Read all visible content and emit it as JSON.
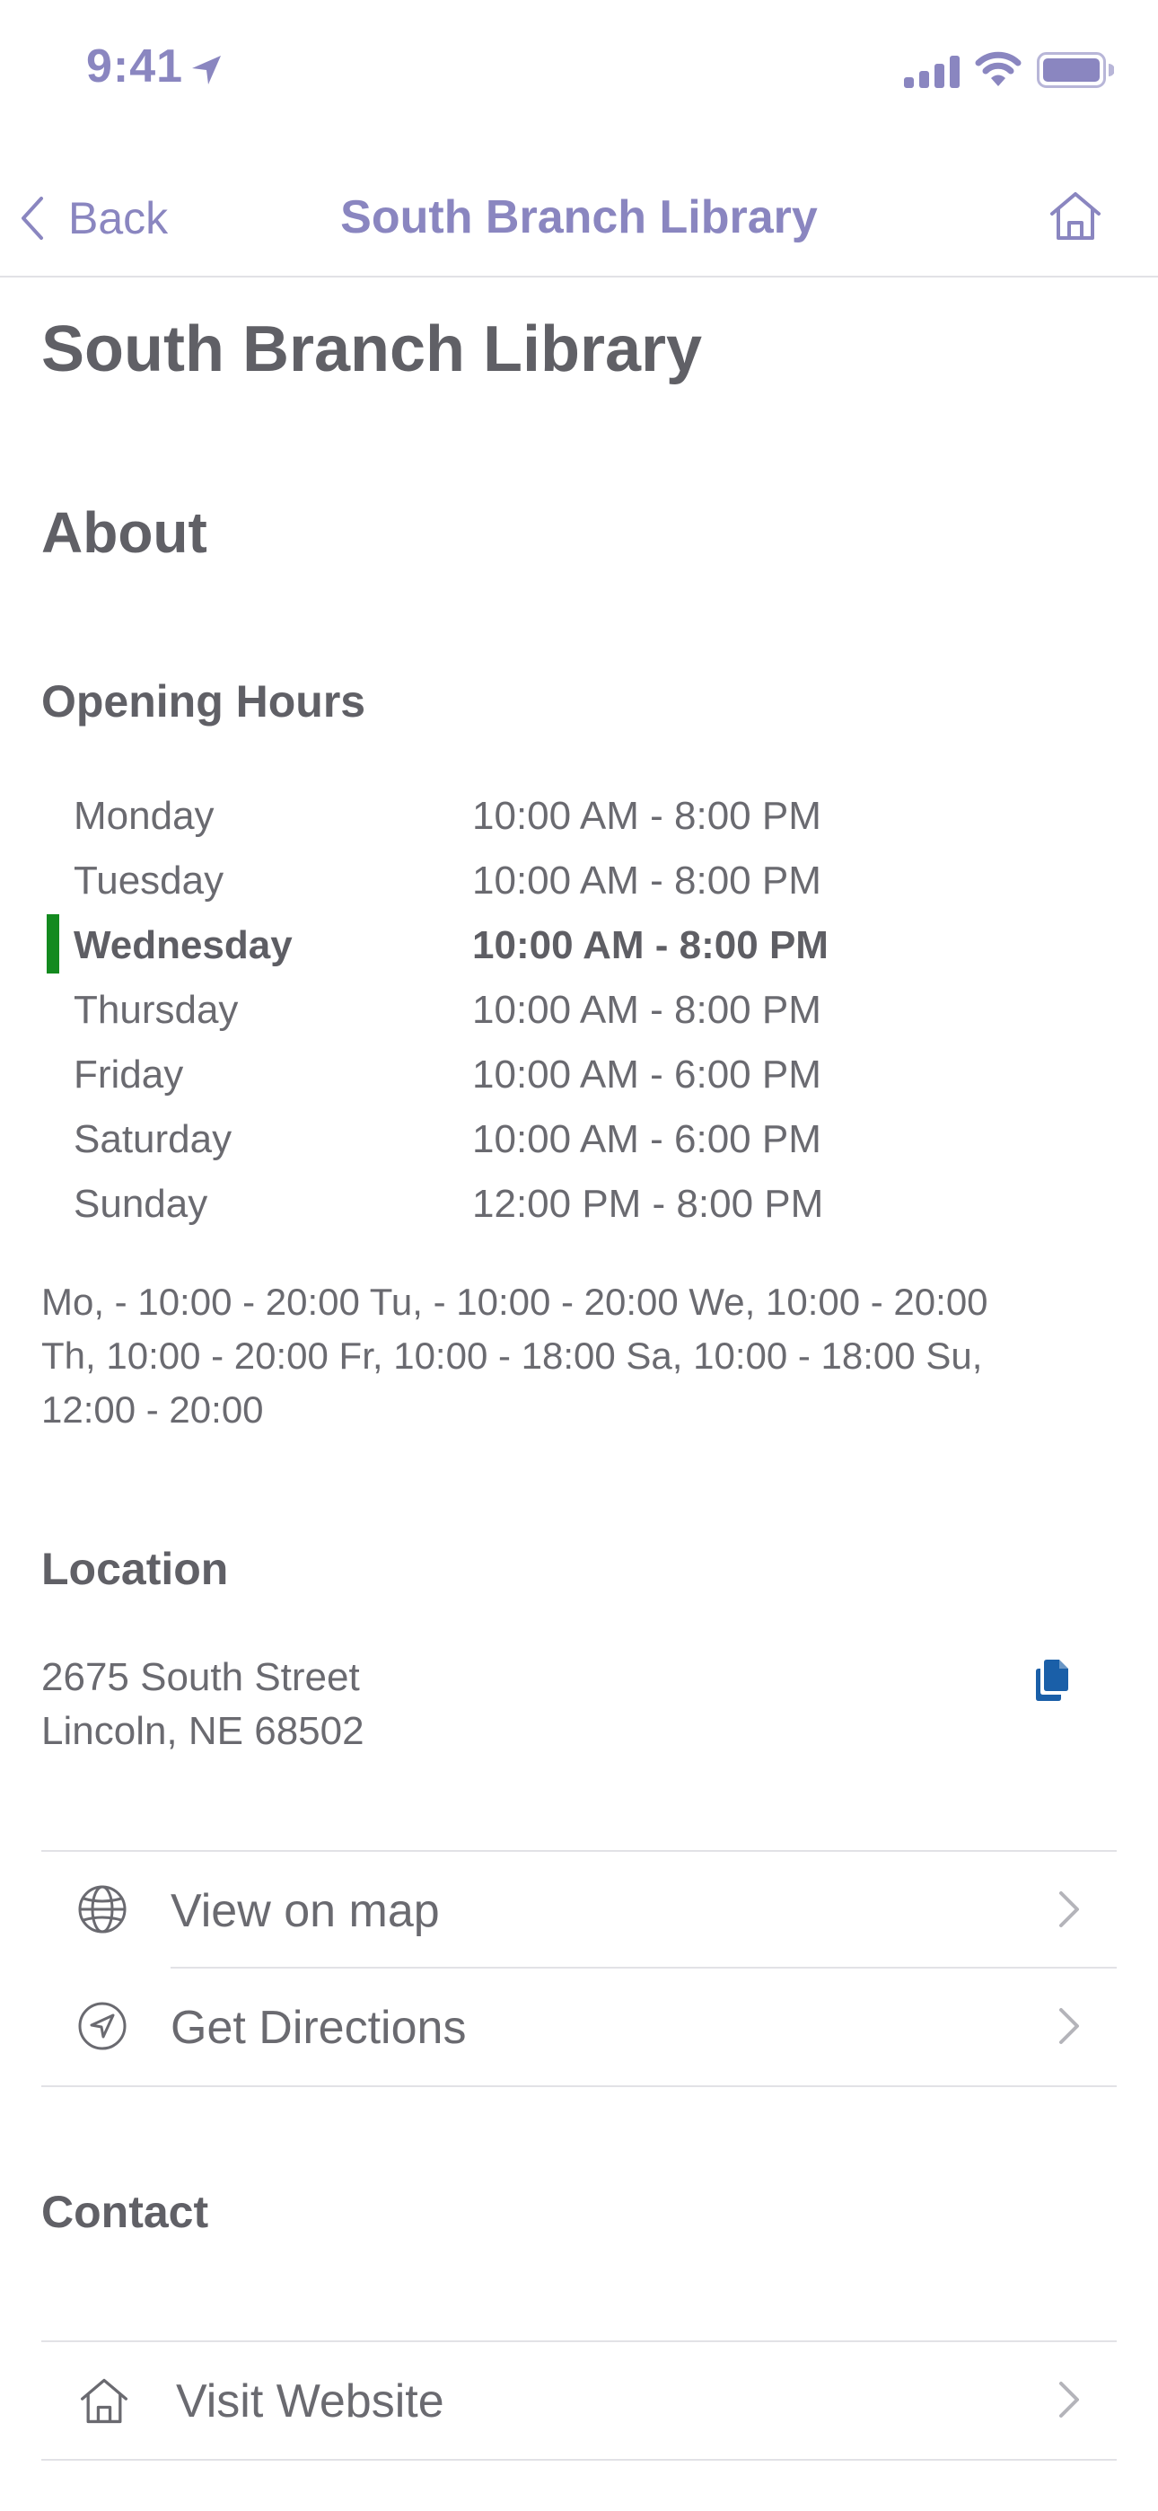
{
  "status_bar": {
    "time": "9:41"
  },
  "nav": {
    "back_label": "Back",
    "title": "South Branch Library"
  },
  "page": {
    "title": "South Branch Library"
  },
  "about": {
    "heading": "About"
  },
  "opening_hours": {
    "heading": "Opening Hours",
    "rows": [
      {
        "day": "Monday",
        "time": "10:00 AM - 8:00 PM",
        "today": false
      },
      {
        "day": "Tuesday",
        "time": "10:00 AM - 8:00 PM",
        "today": false
      },
      {
        "day": "Wednesday",
        "time": "10:00 AM - 8:00 PM",
        "today": true
      },
      {
        "day": "Thursday",
        "time": "10:00 AM - 8:00 PM",
        "today": false
      },
      {
        "day": "Friday",
        "time": "10:00 AM - 6:00 PM",
        "today": false
      },
      {
        "day": "Saturday",
        "time": "10:00 AM - 6:00 PM",
        "today": false
      },
      {
        "day": "Sunday",
        "time": "12:00 PM - 8:00 PM",
        "today": false
      }
    ],
    "raw_line1": "Mo, - 10:00 - 20:00 Tu, - 10:00 - 20:00 We, 10:00 - 20:00",
    "raw_line2": "Th, 10:00 - 20:00 Fr, 10:00 - 18:00 Sa, 10:00 - 18:00 Su,",
    "raw_line3": "12:00 - 20:00"
  },
  "location": {
    "heading": "Location",
    "address_line1": "2675 South Street",
    "address_line2": "Lincoln, NE 68502",
    "view_on_map_label": "View on map",
    "get_directions_label": "Get Directions"
  },
  "contact": {
    "heading": "Contact",
    "visit_website_label": "Visit Website"
  },
  "colors": {
    "accent": "#8a86c0",
    "today_indicator": "#138a1f",
    "copy_icon": "#1a5fa8",
    "text": "#6a6a70"
  }
}
